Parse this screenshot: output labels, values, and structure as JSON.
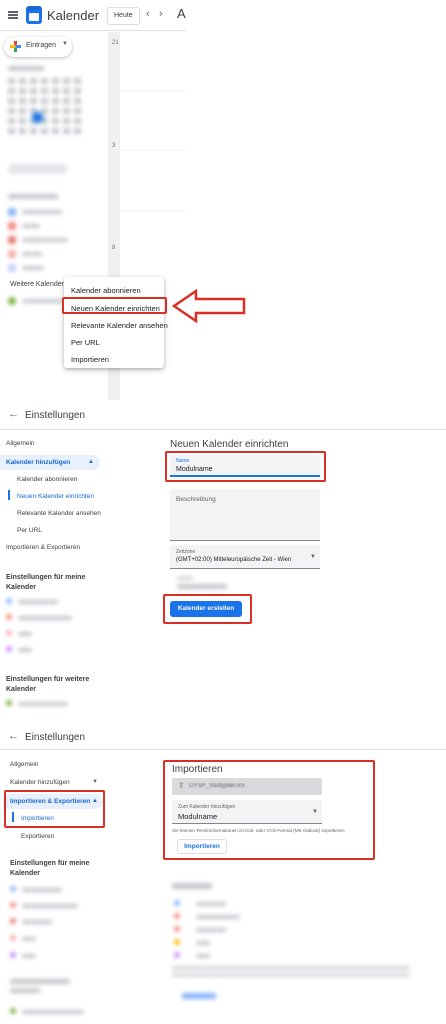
{
  "panel1": {
    "app_title": "Kalender",
    "today_button": "Heute",
    "prev_icon": "chevron-left-icon",
    "next_icon": "chevron-right-icon",
    "overflow_letter": "A",
    "create_button": "Eintragen",
    "day_numbers": [
      "21",
      "3",
      "8"
    ],
    "section_other_calendars": "Weitere Kalender",
    "context_menu": [
      "Kalender abonnieren",
      "Neuen Kalender einrichten",
      "Relevante Kalender ansehen",
      "Per URL",
      "Importieren"
    ],
    "annotation_color": "#d93025"
  },
  "panel2": {
    "title": "Einstellungen",
    "sidebar": {
      "general": "Allgemein",
      "add_calendar": "Kalender hinzufügen",
      "sub_items": [
        "Kalender abonnieren",
        "Neuen Kalender einrichten",
        "Relevante Kalender ansehen",
        "Per URL"
      ],
      "import_export": "Importieren & Exportieren",
      "my_calendars": "Einstellungen für meine Kalender",
      "other_calendars": "Einstellungen für weitere Kalender"
    },
    "section_title": "Neuen Kalender einrichten",
    "name_field": {
      "label": "Name",
      "value": "Modulname"
    },
    "description_placeholder": "Beschreibung",
    "timezone_field": {
      "label": "Zeitzone",
      "value": "(GMT+02:00) Mitteleuropäische Zeit - Wien"
    },
    "create_button": "Kalender erstellen",
    "accent": "#1a73e8"
  },
  "panel3": {
    "title": "Einstellungen",
    "sidebar": {
      "general": "Allgemein",
      "add_calendar": "Kalender hinzufügen",
      "import_export": "Importieren & Exportieren",
      "sub_items": [
        "Importieren",
        "Exportieren"
      ],
      "my_calendars": "Einstellungen für meine Kalender"
    },
    "section_title": "Importieren",
    "upload_file": "GYSP_Studyplan.ics",
    "target_field": {
      "label": "Zum Kalender hinzufügen",
      "value": "Modulname"
    },
    "note": "Sie können Termininformationen im iCal- oder VCS-Format (MS Outlook) importieren",
    "import_button": "Importieren"
  }
}
